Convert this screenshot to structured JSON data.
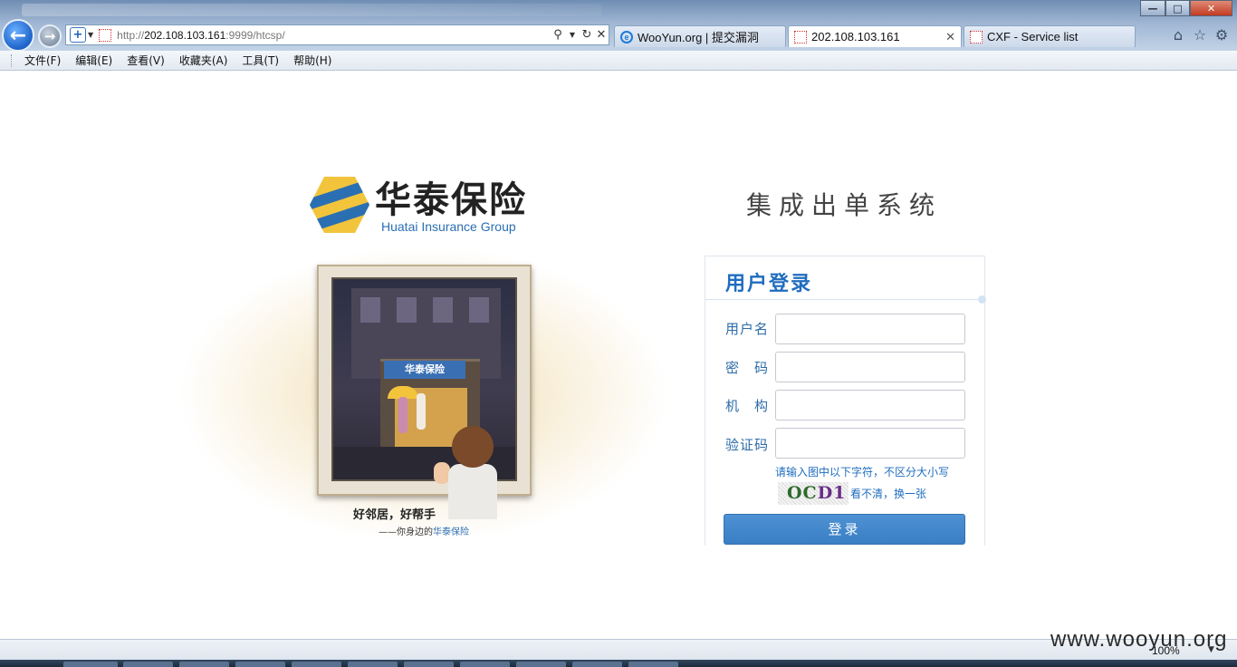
{
  "browser": {
    "address_url_prefix": "http://",
    "address_url_host": "202.108.103.161",
    "address_url_rest": ":9999/htcsp/",
    "tabs": [
      {
        "label": "WooYun.org | 提交漏洞"
      },
      {
        "label": "202.108.103.161"
      },
      {
        "label": "CXF - Service list"
      }
    ],
    "menu": [
      "文件(F)",
      "编辑(E)",
      "查看(V)",
      "收藏夹(A)",
      "工具(T)",
      "帮助(H)"
    ],
    "zoom": "100%",
    "icons": [
      "back-arrow-icon",
      "forward-arrow-icon",
      "search-icon",
      "refresh-icon",
      "close-icon",
      "home-icon",
      "star-icon",
      "gear-icon"
    ]
  },
  "brand": {
    "name_cn": "华泰保险",
    "name_en": "Huatai Insurance Group",
    "colors": {
      "blue": "#2b6fb3",
      "yellow": "#f2c43c"
    }
  },
  "system_title": "集成出单系统",
  "illustration": {
    "sign_text": "华泰保险",
    "slogan": "好邻居，好帮手",
    "tagline_prefix": "——你身边的",
    "tagline_brand": "华泰保险"
  },
  "login": {
    "title": "用户登录",
    "username_label": "用户名",
    "password_label": "密　码",
    "org_label": "机　构",
    "captcha_label": "验证码",
    "username_value": "",
    "password_value": "",
    "org_value": "",
    "captcha_value": "",
    "captcha_hint": "请输入图中以下字符，不区分大小写",
    "captcha_text_a": "OC",
    "captcha_text_b": "D1",
    "refresh_link": "看不清，换一张",
    "submit_label": "登录",
    "accent_color": "#1f6dbf"
  },
  "watermark": "www.wooyun.org"
}
